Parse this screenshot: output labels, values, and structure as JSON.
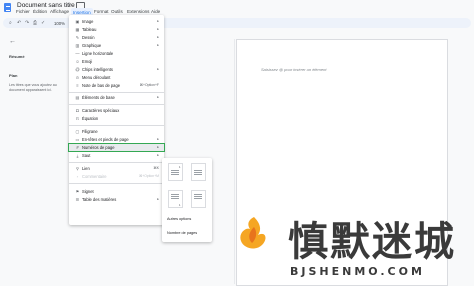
{
  "document": {
    "title": "Document sans titre",
    "body_placeholder": "Saisissez @ pour insérer un élément"
  },
  "menubar": {
    "items": [
      "Fichier",
      "Édition",
      "Affichage",
      "Insertion",
      "Format",
      "Outils",
      "Extensions",
      "Aide"
    ],
    "active_index": 3
  },
  "toolbar": {
    "zoom": "100%"
  },
  "outline": {
    "summary_heading": "Résumé",
    "plan_heading": "Plan",
    "plan_text": "Les titres que vous ajoutez au document apparaissent ici."
  },
  "insert_menu": {
    "items": [
      {
        "label": "Image",
        "icon": "image-icon",
        "shortcut": "▸",
        "enabled": true
      },
      {
        "label": "Tableau",
        "icon": "table-icon",
        "shortcut": "▸",
        "enabled": true
      },
      {
        "label": "Dessin",
        "icon": "drawing-icon",
        "shortcut": "▸",
        "enabled": true
      },
      {
        "label": "Graphique",
        "icon": "chart-icon",
        "shortcut": "▸",
        "enabled": true
      },
      {
        "label": "Ligne horizontale",
        "icon": "horizontal-line-icon",
        "shortcut": "",
        "enabled": true
      },
      {
        "label": "Emoji",
        "icon": "emoji-icon",
        "shortcut": "",
        "enabled": true
      },
      {
        "label": "Chips intelligents",
        "icon": "smart-chips-icon",
        "shortcut": "▸",
        "enabled": true
      },
      {
        "label": "Menu déroulant",
        "icon": "dropdown-icon",
        "shortcut": "",
        "enabled": true
      },
      {
        "label": "Note de bas de page",
        "icon": "footnote-icon",
        "shortcut": "⌘+Option+F",
        "enabled": true
      },
      {
        "label": "Éléments de base",
        "icon": "building-blocks-icon",
        "shortcut": "▸",
        "enabled": true
      },
      {
        "label": "Caractères spéciaux",
        "icon": "special-characters-icon",
        "shortcut": "",
        "enabled": true
      },
      {
        "label": "Équation",
        "icon": "equation-icon",
        "shortcut": "",
        "enabled": true
      },
      {
        "label": "Filigrane",
        "icon": "watermark-icon",
        "shortcut": "",
        "enabled": true
      },
      {
        "label": "En-têtes et pieds de page",
        "icon": "header-footer-icon",
        "shortcut": "▸",
        "enabled": true
      },
      {
        "label": "Numéros de page",
        "icon": "page-numbers-icon",
        "shortcut": "▸",
        "enabled": true,
        "highlighted": true
      },
      {
        "label": "Saut",
        "icon": "break-icon",
        "shortcut": "▸",
        "enabled": true
      },
      {
        "label": "Lien",
        "icon": "link-icon",
        "shortcut": "⌘K",
        "enabled": true
      },
      {
        "label": "Commentaire",
        "icon": "comment-icon",
        "shortcut": "⌘+Option+M",
        "enabled": false
      },
      {
        "label": "Signet",
        "icon": "bookmark-icon",
        "shortcut": "",
        "enabled": true
      },
      {
        "label": "Table des matières",
        "icon": "table-of-contents-icon",
        "shortcut": "▸",
        "enabled": true
      }
    ]
  },
  "page_numbers_submenu": {
    "options": [
      "Autres options",
      "Nombre de pages"
    ]
  },
  "watermark": {
    "title": "慎默迷城",
    "subtitle": "BJSHENMO.COM"
  },
  "colors": {
    "accent": "#1a73e8",
    "highlight_outline": "#34a853",
    "menu_hover": "#e8eaed"
  }
}
